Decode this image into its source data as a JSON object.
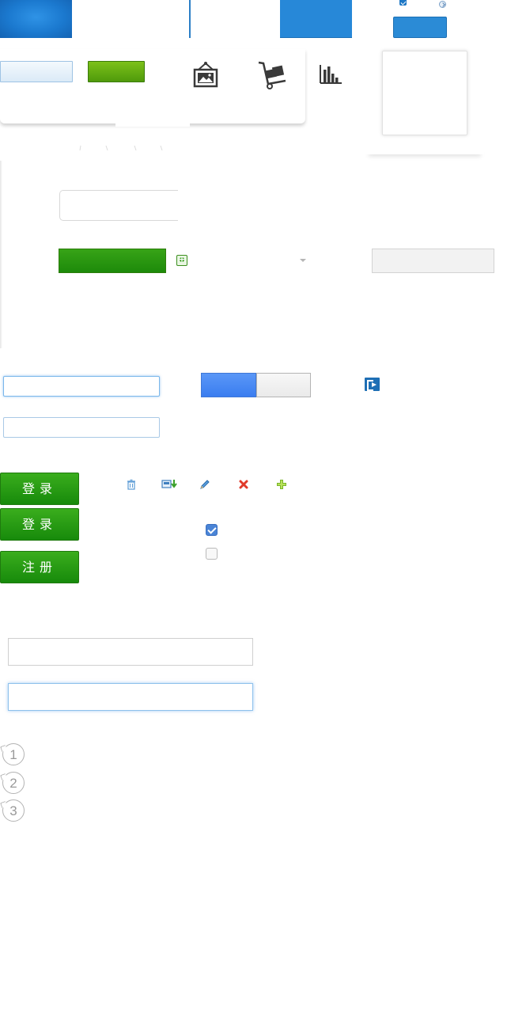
{
  "login": {
    "login_labels": [
      "登录",
      "登录"
    ],
    "register_label": "注册"
  },
  "steps": [
    "1",
    "2",
    "3"
  ],
  "checkboxes": {
    "first_checked": true,
    "second_checked": false
  },
  "colors": {
    "primary_blue": "#2788d8",
    "action_green": "#178a0b",
    "focus_blue": "#7ab7ea"
  },
  "icons": {
    "toolbar": [
      "picture-frame-icon",
      "hand-truck-icon",
      "bar-chart-icon"
    ],
    "actions": [
      "trash-icon",
      "download-icon",
      "pencil-icon",
      "delete-x-icon",
      "add-plus-icon"
    ],
    "misc": [
      "dropdown-caret-icon",
      "add-circle-icon",
      "logout-icon"
    ]
  }
}
